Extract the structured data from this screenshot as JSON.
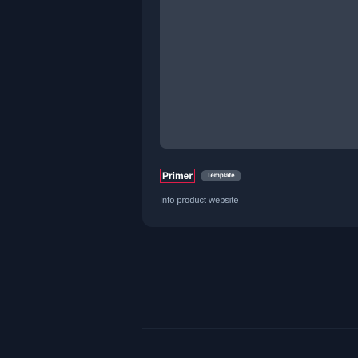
{
  "card": {
    "title": "Primer",
    "tag": "Template",
    "description": "Info product website"
  }
}
